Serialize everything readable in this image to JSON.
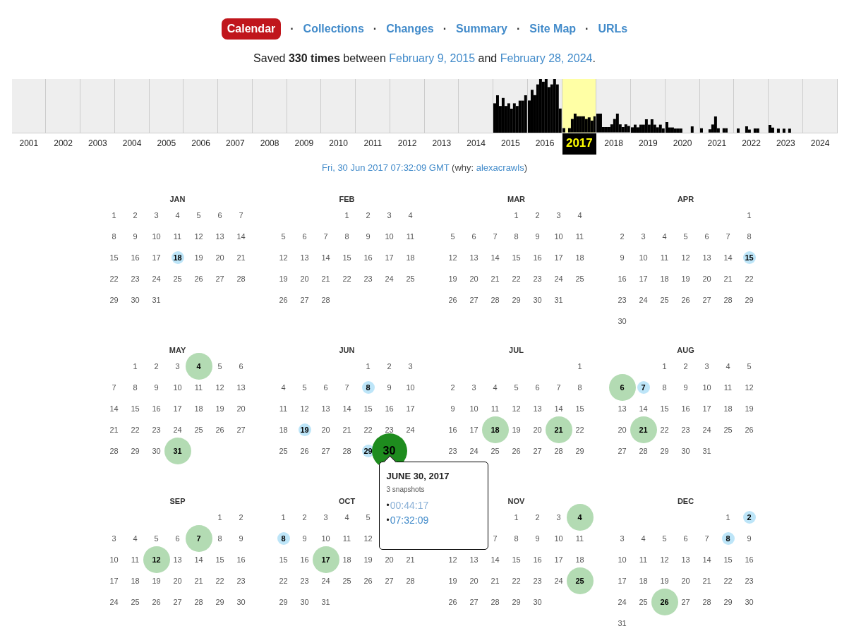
{
  "nav": [
    {
      "kind": "tab",
      "label": "Calendar",
      "selected": true
    },
    {
      "kind": "separator",
      "label": "·"
    },
    {
      "kind": "tab",
      "label": "Collections",
      "selected": false
    },
    {
      "kind": "separator",
      "label": "·"
    },
    {
      "kind": "tab",
      "label": "Changes",
      "selected": false
    },
    {
      "kind": "separator",
      "label": "·"
    },
    {
      "kind": "tab",
      "label": "Summary",
      "selected": false
    },
    {
      "kind": "separator",
      "label": "·"
    },
    {
      "kind": "tab",
      "label": "Site Map",
      "selected": false
    },
    {
      "kind": "separator",
      "label": "·"
    },
    {
      "kind": "tab",
      "label": "URLs",
      "selected": false
    }
  ],
  "summary": {
    "before": "Saved **330 times** between",
    "start": "February 9, 2015",
    "middle": "and",
    "end": "February 28, 2024",
    "after": "."
  },
  "years": [
    {
      "label": "2001",
      "selected": false
    },
    {
      "label": "2002",
      "selected": false
    },
    {
      "label": "2003",
      "selected": false
    },
    {
      "label": "2004",
      "selected": false
    },
    {
      "label": "2005",
      "selected": false
    },
    {
      "label": "2006",
      "selected": false
    },
    {
      "label": "2007",
      "selected": false
    },
    {
      "label": "2008",
      "selected": false
    },
    {
      "label": "2009",
      "selected": false
    },
    {
      "label": "2010",
      "selected": false
    },
    {
      "label": "2011",
      "selected": false
    },
    {
      "label": "2012",
      "selected": false
    },
    {
      "label": "2013",
      "selected": false
    },
    {
      "label": "2014",
      "selected": false
    },
    {
      "label": "2015",
      "selected": false
    },
    {
      "label": "2016",
      "selected": false
    },
    {
      "label": "2017",
      "selected": true
    },
    {
      "label": "2018",
      "selected": false
    },
    {
      "label": "2019",
      "selected": false
    },
    {
      "label": "2020",
      "selected": false
    },
    {
      "label": "2021",
      "selected": false
    },
    {
      "label": "2022",
      "selected": false
    },
    {
      "label": "2023",
      "selected": false
    },
    {
      "label": "2024",
      "selected": false
    }
  ],
  "capture": {
    "timestamp": "Fri, 30 Jun 2017 07:32:09 GMT",
    "why_label": "(why:",
    "why_link": "alexacrawls",
    "close": ")"
  },
  "months": [
    {
      "name": "JAN",
      "weeks": [
        {
          "days": [
            "1",
            "2",
            "3",
            "4",
            "5",
            "6",
            "7"
          ]
        },
        {
          "days": [
            "8",
            "9",
            "10",
            "11",
            "12",
            "13",
            "14"
          ]
        },
        {
          "days": [
            "15",
            "16",
            "17",
            {
              "day": "18",
              "kind": "few"
            },
            "19",
            "20",
            "21"
          ]
        },
        {
          "days": [
            "22",
            "23",
            "24",
            "25",
            "26",
            "27",
            "28"
          ]
        },
        {
          "right_aligned": false,
          "days": [
            "29",
            "30",
            "31"
          ]
        }
      ]
    },
    {
      "name": "FEB",
      "weeks": [
        {
          "right_aligned": true,
          "days": [
            "1",
            "2",
            "3",
            "4"
          ]
        },
        {
          "days": [
            "5",
            "6",
            "7",
            "8",
            "9",
            "10",
            "11"
          ]
        },
        {
          "days": [
            "12",
            "13",
            "14",
            "15",
            "16",
            "17",
            "18"
          ]
        },
        {
          "days": [
            "19",
            "20",
            "21",
            "22",
            "23",
            "24",
            "25"
          ]
        },
        {
          "right_aligned": false,
          "days": [
            "26",
            "27",
            "28"
          ]
        }
      ]
    },
    {
      "name": "MAR",
      "weeks": [
        {
          "right_aligned": true,
          "days": [
            "1",
            "2",
            "3",
            "4"
          ]
        },
        {
          "days": [
            "5",
            "6",
            "7",
            "8",
            "9",
            "10",
            "11"
          ]
        },
        {
          "days": [
            "12",
            "13",
            "14",
            "15",
            "16",
            "17",
            "18"
          ]
        },
        {
          "days": [
            "19",
            "20",
            "21",
            "22",
            "23",
            "24",
            "25"
          ]
        },
        {
          "right_aligned": false,
          "days": [
            "26",
            "27",
            "28",
            "29",
            "30",
            "31"
          ]
        }
      ]
    },
    {
      "name": "APR",
      "weeks": [
        {
          "right_aligned": true,
          "days": [
            "1"
          ]
        },
        {
          "days": [
            "2",
            "3",
            "4",
            "5",
            "6",
            "7",
            "8"
          ]
        },
        {
          "days": [
            "9",
            "10",
            "11",
            "12",
            "13",
            "14",
            {
              "day": "15",
              "kind": "few"
            }
          ]
        },
        {
          "days": [
            "16",
            "17",
            "18",
            "19",
            "20",
            "21",
            "22"
          ]
        },
        {
          "days": [
            "23",
            "24",
            "25",
            "26",
            "27",
            "28",
            "29"
          ]
        },
        {
          "right_aligned": false,
          "days": [
            "30"
          ]
        }
      ]
    },
    {
      "name": "MAY",
      "weeks": [
        {
          "right_aligned": true,
          "days": [
            "1",
            "2",
            "3",
            {
              "day": "4",
              "kind": "many"
            },
            "5",
            "6"
          ]
        },
        {
          "days": [
            "7",
            "8",
            "9",
            "10",
            "11",
            "12",
            "13"
          ]
        },
        {
          "days": [
            "14",
            "15",
            "16",
            "17",
            "18",
            "19",
            "20"
          ]
        },
        {
          "days": [
            "21",
            "22",
            "23",
            "24",
            "25",
            "26",
            "27"
          ]
        },
        {
          "right_aligned": false,
          "days": [
            "28",
            "29",
            "30",
            {
              "day": "31",
              "kind": "many"
            }
          ]
        }
      ]
    },
    {
      "name": "JUN",
      "weeks": [
        {
          "right_aligned": true,
          "days": [
            "1",
            "2",
            "3"
          ]
        },
        {
          "days": [
            "4",
            "5",
            "6",
            "7",
            {
              "day": "8",
              "kind": "few"
            },
            "9",
            "10"
          ]
        },
        {
          "days": [
            "11",
            "12",
            "13",
            "14",
            "15",
            "16",
            "17"
          ]
        },
        {
          "days": [
            "18",
            {
              "day": "19",
              "kind": "few"
            },
            "20",
            "21",
            "22",
            "23",
            "24"
          ]
        },
        {
          "right_aligned": false,
          "days": [
            "25",
            "26",
            "27",
            "28",
            {
              "day": "29",
              "kind": "few"
            },
            {
              "day": "30",
              "kind": "current"
            }
          ]
        }
      ]
    },
    {
      "name": "JUL",
      "weeks": [
        {
          "right_aligned": true,
          "days": [
            "1"
          ]
        },
        {
          "days": [
            "2",
            "3",
            "4",
            "5",
            "6",
            "7",
            "8"
          ]
        },
        {
          "days": [
            "9",
            "10",
            "11",
            "12",
            "13",
            "14",
            "15"
          ]
        },
        {
          "days": [
            "16",
            "17",
            {
              "day": "18",
              "kind": "many"
            },
            "19",
            "20",
            {
              "day": "21",
              "kind": "many"
            },
            "22"
          ]
        },
        {
          "days": [
            "23",
            "24",
            "25",
            "26",
            "27",
            "28",
            "29"
          ]
        }
      ]
    },
    {
      "name": "AUG",
      "weeks": [
        {
          "right_aligned": true,
          "days": [
            "1",
            "2",
            "3",
            "4",
            "5"
          ]
        },
        {
          "days": [
            {
              "day": "6",
              "kind": "many"
            },
            {
              "day": "7",
              "kind": "few"
            },
            "8",
            "9",
            "10",
            "11",
            "12"
          ]
        },
        {
          "days": [
            "13",
            "14",
            "15",
            "16",
            "17",
            "18",
            "19"
          ]
        },
        {
          "days": [
            "20",
            {
              "day": "21",
              "kind": "many"
            },
            "22",
            "23",
            "24",
            "25",
            "26"
          ]
        },
        {
          "right_aligned": false,
          "days": [
            "27",
            "28",
            "29",
            "30",
            "31"
          ]
        }
      ]
    },
    {
      "name": "SEP",
      "weeks": [
        {
          "right_aligned": true,
          "days": [
            "1",
            "2"
          ]
        },
        {
          "days": [
            "3",
            "4",
            "5",
            "6",
            {
              "day": "7",
              "kind": "many"
            },
            "8",
            "9"
          ]
        },
        {
          "days": [
            "10",
            "11",
            {
              "day": "12",
              "kind": "many"
            },
            "13",
            "14",
            "15",
            "16"
          ]
        },
        {
          "days": [
            "17",
            "18",
            "19",
            "20",
            "21",
            "22",
            "23"
          ]
        },
        {
          "days": [
            "24",
            "25",
            "26",
            "27",
            "28",
            "29",
            "30"
          ]
        }
      ]
    },
    {
      "name": "OCT",
      "weeks": [
        {
          "right_aligned": false,
          "days": [
            "1",
            "2",
            "3",
            "4",
            "5"
          ]
        },
        {
          "right_aligned": false,
          "days": [
            {
              "day": "8",
              "kind": "few"
            },
            "9",
            "10",
            "11",
            "12"
          ]
        },
        {
          "days": [
            "15",
            "16",
            {
              "day": "17",
              "kind": "many"
            },
            "18",
            "19",
            "20",
            "21"
          ]
        },
        {
          "days": [
            "22",
            "23",
            "24",
            "25",
            "26",
            "27",
            "28"
          ]
        },
        {
          "right_aligned": false,
          "days": [
            "29",
            "30",
            "31"
          ]
        }
      ]
    },
    {
      "name": "NOV",
      "weeks": [
        {
          "right_aligned": true,
          "days": [
            "1",
            "2",
            "3",
            {
              "day": "4",
              "kind": "many"
            }
          ]
        },
        {
          "right_aligned": true,
          "days": [
            "7",
            "8",
            "9",
            "10",
            "11"
          ]
        },
        {
          "days": [
            "12",
            "13",
            "14",
            "15",
            "16",
            "17",
            "18"
          ]
        },
        {
          "days": [
            "19",
            "20",
            "21",
            "22",
            "23",
            "24",
            {
              "day": "25",
              "kind": "many"
            }
          ]
        },
        {
          "right_aligned": false,
          "days": [
            "26",
            "27",
            "28",
            "29",
            "30"
          ]
        }
      ]
    },
    {
      "name": "DEC",
      "weeks": [
        {
          "right_aligned": true,
          "days": [
            "1",
            {
              "day": "2",
              "kind": "few"
            }
          ]
        },
        {
          "days": [
            "3",
            "4",
            "5",
            "6",
            "7",
            {
              "day": "8",
              "kind": "few"
            },
            "9"
          ]
        },
        {
          "days": [
            "10",
            "11",
            "12",
            "13",
            "14",
            "15",
            "16"
          ]
        },
        {
          "days": [
            "17",
            "18",
            "19",
            "20",
            "21",
            "22",
            "23"
          ]
        },
        {
          "days": [
            "24",
            "25",
            {
              "day": "26",
              "kind": "many"
            },
            "27",
            "28",
            "29",
            "30"
          ]
        },
        {
          "right_aligned": false,
          "days": [
            "31"
          ]
        }
      ]
    }
  ],
  "popup": {
    "title": "JUNE 30, 2017",
    "count": "3 snapshots",
    "bullet": "•",
    "times": [
      {
        "label": "00:44:17",
        "visited": true
      },
      {
        "label": "07:32:09",
        "visited": false
      }
    ]
  }
}
